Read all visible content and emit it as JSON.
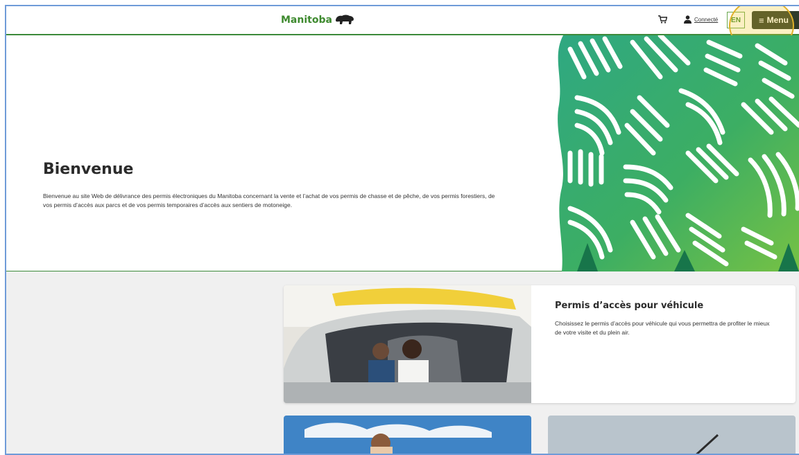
{
  "header": {
    "logo_text": "Manitoba",
    "account_link": "Connecté",
    "lang_button": "EN",
    "menu_button": "Menu",
    "brand_color": "#3e8a2f"
  },
  "hero": {
    "title": "Bienvenue",
    "description": "Bienvenue au site Web de délivrance des permis électroniques du Manitoba concernant la vente et l’achat de vos permis de chasse et de pêche, de vos permis forestiers, de vos permis d’accès aux parcs et de vos permis temporaires d’accès aux sentiers de motoneige."
  },
  "cards": [
    {
      "title": "Permis d’accès pour véhicule",
      "description": "Choisissez le permis d’accès pour véhicule qui vous permettra de profiter le mieux de votre visite et du plein air."
    }
  ],
  "icons": [
    "bison-icon",
    "cart-icon",
    "user-icon",
    "hamburger-icon"
  ]
}
